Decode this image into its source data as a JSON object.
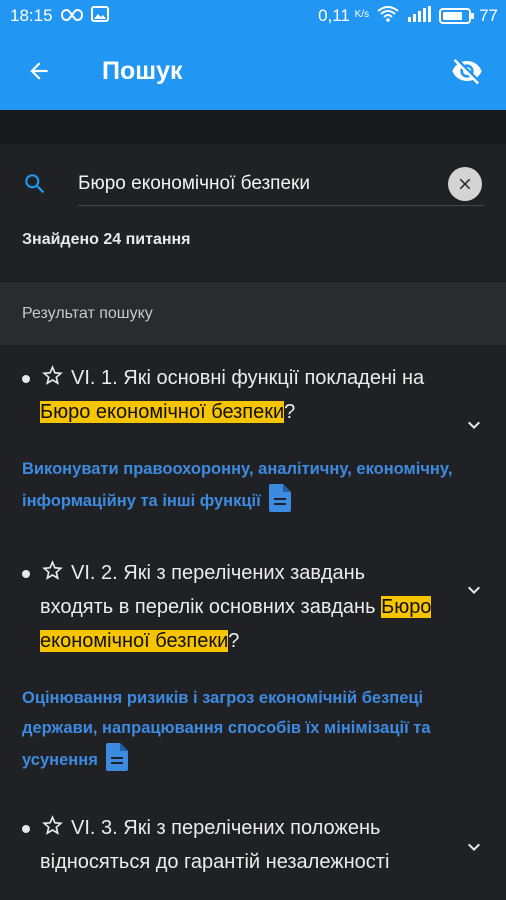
{
  "status_bar": {
    "time": "18:15",
    "network_speed": "0,11",
    "speed_unit": "K/s",
    "battery_level": "77",
    "battery_fraction": 0.77,
    "icons": [
      "infinity-icon",
      "image-icon",
      "wifi-icon",
      "signal-icon",
      "battery-icon"
    ]
  },
  "app_bar": {
    "title": "Пошук",
    "back_icon": "arrow-back-icon",
    "visibility_icon": "eye-off-icon",
    "color": "#2196F3"
  },
  "search": {
    "query": "Бюро економічної безпеки",
    "found_text": "Знайдено 24 питання"
  },
  "section_title": "Результат пошуку",
  "highlight_color": "#F7C400",
  "answer_color": "#3D8BE0",
  "results": [
    {
      "q_before": "VI. 1. Які основні функції покладені на ",
      "q_highlight": "Бюро економічної безпеки",
      "q_after": "?",
      "answer": "Виконувати правоохоронну, аналітичну, економічну, інформаційну та інші функції"
    },
    {
      "q_before": "VI. 2. Які з перелічених завдань входять в перелік основних завдань ",
      "q_highlight": "Бюро економічної безпеки",
      "q_after": "?",
      "answer": "Оцінювання ризиків і загроз економічній безпеці держави, напрацювання способів їх мінімізації та усунення"
    },
    {
      "q_before": "VI. 3. Які з перелічених положень відносяться до гарантій незалежності",
      "q_highlight": "",
      "q_after": "",
      "answer": ""
    }
  ]
}
